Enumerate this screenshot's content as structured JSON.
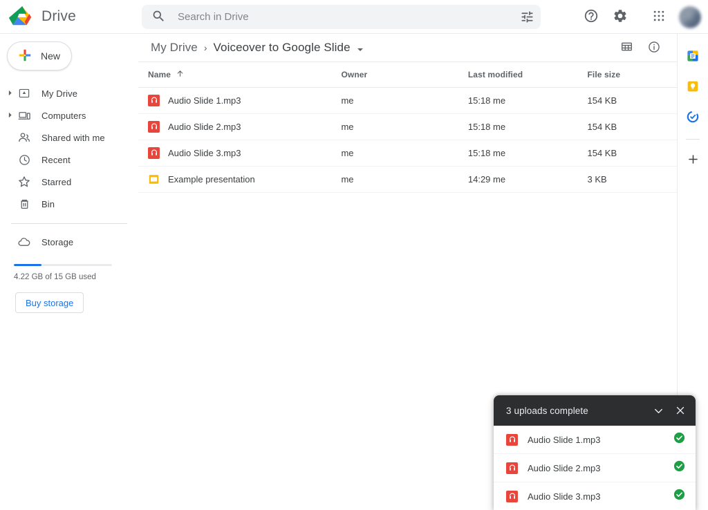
{
  "app": {
    "name": "Drive",
    "logo_icon": "drive-logo-icon"
  },
  "search": {
    "placeholder": "Search in Drive",
    "value": "",
    "search_icon": "search-icon",
    "filter_icon": "tune-filter-icon"
  },
  "header_actions": [
    {
      "name": "help-button",
      "icon": "help-circle-icon"
    },
    {
      "name": "settings-button",
      "icon": "gear-icon"
    },
    {
      "name": "google-apps-button",
      "icon": "apps-grid-icon"
    },
    {
      "name": "account-avatar",
      "icon": "avatar"
    }
  ],
  "sidebar": {
    "new_button": {
      "label": "New",
      "icon": "plus-multicolor-icon"
    },
    "items": [
      {
        "label": "My Drive",
        "icon": "my-drive-icon",
        "expandable": true
      },
      {
        "label": "Computers",
        "icon": "computers-icon",
        "expandable": true
      },
      {
        "label": "Shared with me",
        "icon": "shared-with-me-icon",
        "expandable": false
      },
      {
        "label": "Recent",
        "icon": "clock-icon",
        "expandable": false
      },
      {
        "label": "Starred",
        "icon": "star-icon",
        "expandable": false
      },
      {
        "label": "Bin",
        "icon": "trash-icon",
        "expandable": false
      }
    ],
    "storage": {
      "label": "Storage",
      "icon": "cloud-icon",
      "used_text": "4.22 GB of 15 GB used",
      "percent_used": 28,
      "buy_label": "Buy storage",
      "bar_color": "#1a73e8"
    }
  },
  "breadcrumb": {
    "root": "My Drive",
    "separator": "›",
    "current": "Voiceover to Google Slide",
    "caret_icon": "chevron-down-icon",
    "actions": [
      {
        "name": "grid-view-button",
        "icon": "grid-view-icon"
      },
      {
        "name": "details-button",
        "icon": "info-circle-icon"
      }
    ]
  },
  "table": {
    "columns": [
      {
        "key": "name",
        "label": "Name",
        "sort_icon": "arrow-up-icon"
      },
      {
        "key": "owner",
        "label": "Owner"
      },
      {
        "key": "last_modified",
        "label": "Last modified"
      },
      {
        "key": "file_size",
        "label": "File size"
      }
    ],
    "rows": [
      {
        "name": "Audio Slide 1.mp3",
        "icon": "audio-file-icon",
        "owner": "me",
        "last_modified": "15:18 me",
        "file_size": "154 KB"
      },
      {
        "name": "Audio Slide 2.mp3",
        "icon": "audio-file-icon",
        "owner": "me",
        "last_modified": "15:18 me",
        "file_size": "154 KB"
      },
      {
        "name": "Audio Slide 3.mp3",
        "icon": "audio-file-icon",
        "owner": "me",
        "last_modified": "15:18 me",
        "file_size": "154 KB"
      },
      {
        "name": "Example presentation",
        "icon": "slides-file-icon",
        "owner": "me",
        "last_modified": "14:29 me",
        "file_size": "3 KB"
      }
    ]
  },
  "right_rail": {
    "apps": [
      {
        "name": "google-calendar-icon"
      },
      {
        "name": "google-keep-icon"
      },
      {
        "name": "google-tasks-icon"
      }
    ],
    "add_button": {
      "name": "add-app-icon",
      "label": "+"
    }
  },
  "upload_toast": {
    "title": "3 uploads complete",
    "collapse_icon": "chevron-down-icon",
    "close_icon": "close-icon",
    "items": [
      {
        "name": "Audio Slide 1.mp3",
        "icon": "audio-file-icon",
        "status_icon": "check-circle-icon"
      },
      {
        "name": "Audio Slide 2.mp3",
        "icon": "audio-file-icon",
        "status_icon": "check-circle-icon"
      },
      {
        "name": "Audio Slide 3.mp3",
        "icon": "audio-file-icon",
        "status_icon": "check-circle-icon"
      }
    ],
    "status_color": "#1e9e45"
  }
}
